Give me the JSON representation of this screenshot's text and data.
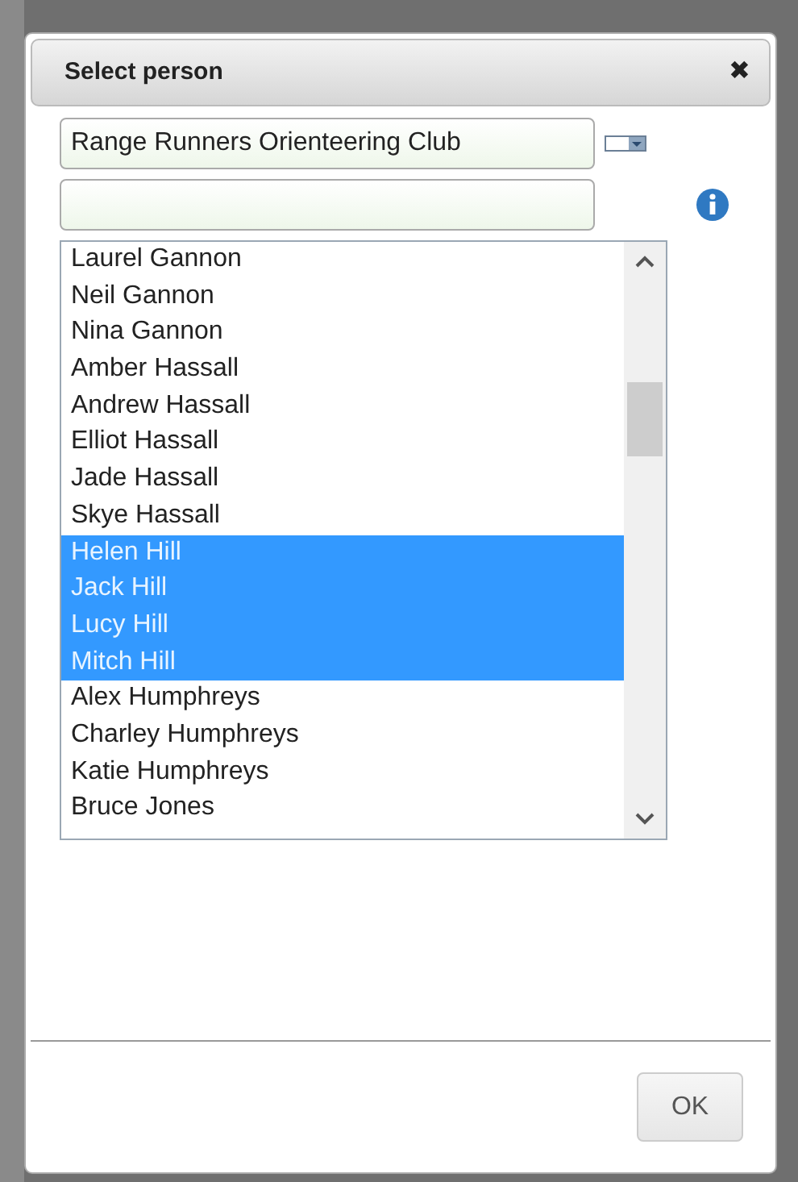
{
  "dialog": {
    "title": "Select person",
    "close_label": "✖"
  },
  "club_field": {
    "value": "Range Runners Orienteering Club"
  },
  "people": [
    {
      "name": "Laurel Gannon",
      "selected": false
    },
    {
      "name": "Neil Gannon",
      "selected": false
    },
    {
      "name": "Nina Gannon",
      "selected": false
    },
    {
      "name": "Amber Hassall",
      "selected": false
    },
    {
      "name": "Andrew Hassall",
      "selected": false
    },
    {
      "name": "Elliot Hassall",
      "selected": false
    },
    {
      "name": "Jade Hassall",
      "selected": false
    },
    {
      "name": "Skye Hassall",
      "selected": false
    },
    {
      "name": "Helen Hill",
      "selected": true
    },
    {
      "name": "Jack Hill",
      "selected": true
    },
    {
      "name": "Lucy Hill",
      "selected": true
    },
    {
      "name": "Mitch Hill",
      "selected": true
    },
    {
      "name": "Alex Humphreys",
      "selected": false
    },
    {
      "name": "Charley Humphreys",
      "selected": false
    },
    {
      "name": "Katie Humphreys",
      "selected": false
    },
    {
      "name": "Bruce Jones",
      "selected": false
    }
  ],
  "buttons": [
    {
      "label": "OK"
    }
  ]
}
